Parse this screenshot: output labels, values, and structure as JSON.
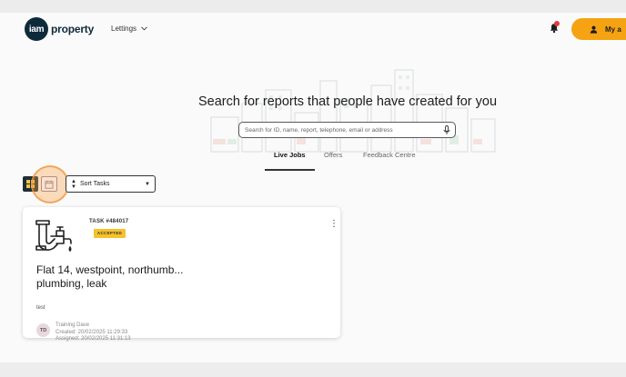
{
  "header": {
    "logo_mark": "iam",
    "logo_text": "property",
    "nav_menu": "Lettings",
    "account_label": "My a"
  },
  "hero": {
    "title": "Search for reports that people have created for you",
    "search_placeholder": "Search for ID, name, report, telephone, email or address"
  },
  "tabs": [
    {
      "label": "Live Jobs",
      "active": true
    },
    {
      "label": "Offers",
      "active": false
    },
    {
      "label": "Feedback Centre",
      "active": false
    }
  ],
  "controls": {
    "sort_label": "Sort Tasks"
  },
  "card": {
    "task_id": "TASK #484017",
    "status": "ACCEPTED",
    "title_line1": "Flat 14, westpoint, northumb...",
    "title_line2": "plumbing, leak",
    "subtitle": "test",
    "avatar_initials": "TD",
    "owner": "Training Dave",
    "created": "Created: 20/02/2025 11:29:33",
    "assigned": "Assigned: 20/02/2025 11:31:13"
  },
  "colors": {
    "brand_dark": "#0e2a3a",
    "accent_orange": "#f6a313",
    "badge_yellow": "#f6c22b",
    "notification_red": "#e23b3b"
  }
}
